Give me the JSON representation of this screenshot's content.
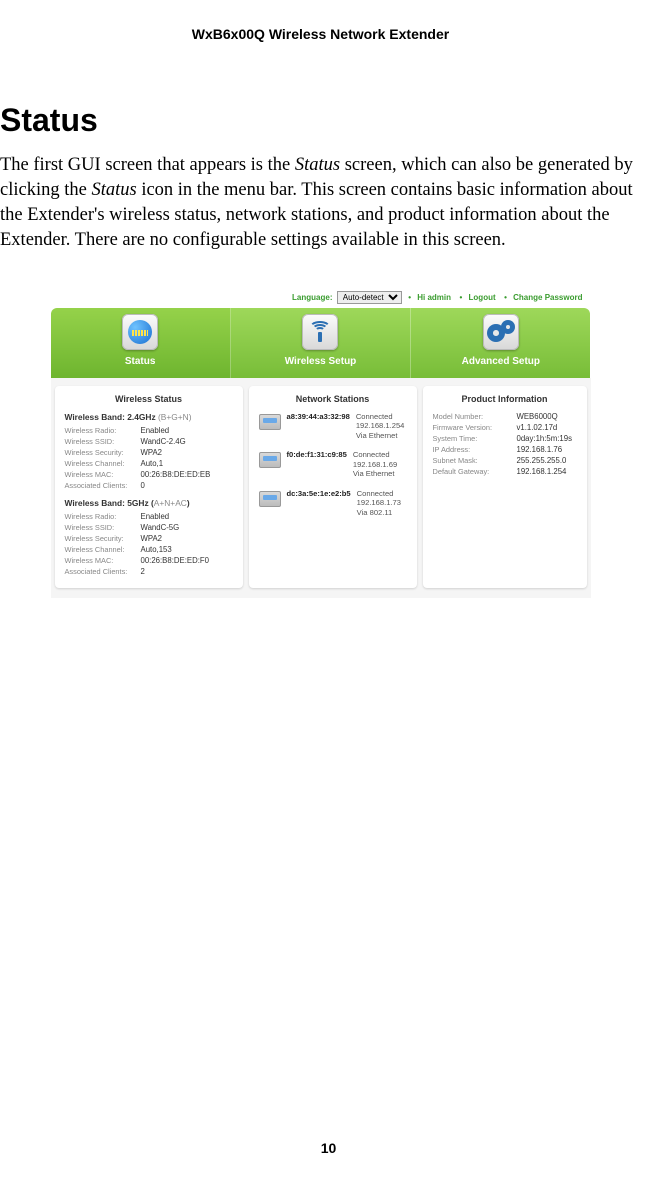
{
  "doc": {
    "header": "WxB6x00Q Wireless Network Extender",
    "section_title": "Status",
    "para_pre": "The first GUI screen that appears is the ",
    "para_em1": "Status",
    "para_mid1": " screen, which can also be generated by clicking the ",
    "para_em2": "Status",
    "para_mid2": " icon in the menu bar. This screen contains basic information about the Extender's wireless status, network stations, and product information about the Extender. There are no configurable settings available in this screen.",
    "page_number": "10"
  },
  "ui": {
    "topbar": {
      "language_label": "Language:",
      "language_value": "Auto-detect",
      "hi_admin": "Hi admin",
      "logout": "Logout",
      "change_password": "Change Password",
      "bullet": "•"
    },
    "nav": {
      "status": "Status",
      "wireless_setup": "Wireless Setup",
      "advanced_setup": "Advanced Setup"
    },
    "wireless_status": {
      "title": "Wireless Status",
      "band24": {
        "head_strong": "Wireless Band: 2.4GHz",
        "head_gray": "(B+G+N)",
        "rows": [
          {
            "k": "Wireless Radio:",
            "v": "Enabled"
          },
          {
            "k": "Wireless SSID:",
            "v": "WandC-2.4G"
          },
          {
            "k": "Wireless Security:",
            "v": "WPA2"
          },
          {
            "k": "Wireless Channel:",
            "v": "Auto,1"
          },
          {
            "k": "Wireless MAC:",
            "v": "00:26:B8:DE:ED:EB"
          },
          {
            "k": "Associated Clients:",
            "v": "0"
          }
        ]
      },
      "band5": {
        "head_strong": "Wireless Band: 5GHz (",
        "head_gray": "A+N+AC",
        "head_close": ")",
        "rows": [
          {
            "k": "Wireless Radio:",
            "v": "Enabled"
          },
          {
            "k": "Wireless SSID:",
            "v": "WandC-5G"
          },
          {
            "k": "Wireless Security:",
            "v": "WPA2"
          },
          {
            "k": "Wireless Channel:",
            "v": "Auto,153"
          },
          {
            "k": "Wireless MAC:",
            "v": "00:26:B8:DE:ED:F0"
          },
          {
            "k": "Associated Clients:",
            "v": "2"
          }
        ]
      }
    },
    "network_stations": {
      "title": "Network Stations",
      "items": [
        {
          "mac": "a8:39:44:a3:32:98",
          "line1": "Connected",
          "line2": "192.168.1.254",
          "line3": "Via Ethernet"
        },
        {
          "mac": "f0:de:f1:31:c9:85",
          "line1": "Connected",
          "line2": "192.168.1.69",
          "line3": "Via Ethernet"
        },
        {
          "mac": "dc:3a:5e:1e:e2:b5",
          "line1": "Connected",
          "line2": "192.168.1.73",
          "line3": "Via 802.11"
        }
      ]
    },
    "product_info": {
      "title": "Product Information",
      "rows": [
        {
          "k": "Model Number:",
          "v": "WEB6000Q"
        },
        {
          "k": "Firmware Version:",
          "v": "v1.1.02.17d"
        },
        {
          "k": "System Time:",
          "v": "0day:1h:5m:19s"
        },
        {
          "k": "IP Address:",
          "v": "192.168.1.76"
        },
        {
          "k": "Subnet Mask:",
          "v": "255.255.255.0"
        },
        {
          "k": "Default Gateway:",
          "v": "192.168.1.254"
        }
      ]
    }
  }
}
